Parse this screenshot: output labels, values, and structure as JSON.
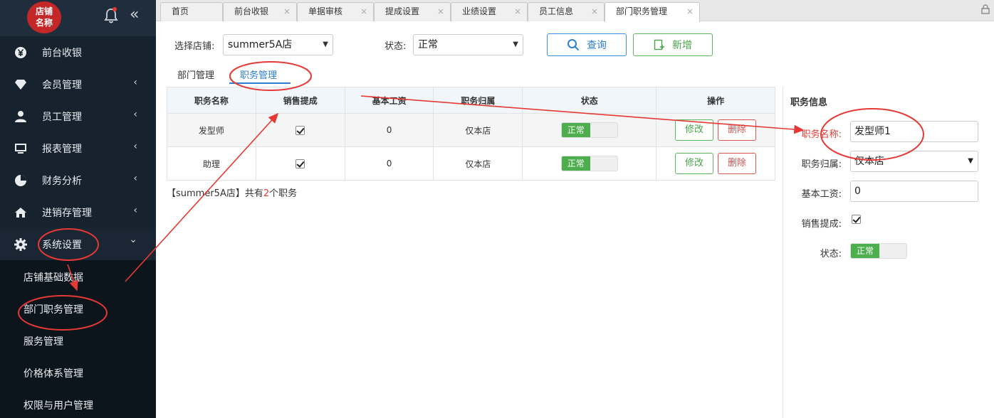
{
  "sidebar": {
    "logo_line1": "店铺",
    "logo_line2": "名称",
    "collapse_glyph": "«",
    "menu": [
      {
        "label": "前台收银",
        "icon": "yen-icon",
        "arrow": ""
      },
      {
        "label": "会员管理",
        "icon": "diamond-icon",
        "arrow": "‹"
      },
      {
        "label": "员工管理",
        "icon": "user-icon",
        "arrow": "‹"
      },
      {
        "label": "报表管理",
        "icon": "monitor-icon",
        "arrow": "‹"
      },
      {
        "label": "财务分析",
        "icon": "pie-chart-icon",
        "arrow": "‹"
      },
      {
        "label": "进销存管理",
        "icon": "home-icon",
        "arrow": "‹"
      },
      {
        "label": "系统设置",
        "icon": "gear-icon",
        "arrow": "⌄"
      }
    ],
    "submenu": [
      "店铺基础数据",
      "部门职务管理",
      "服务管理",
      "价格体系管理",
      "权限与用户管理"
    ]
  },
  "tabs": [
    {
      "label": "首页",
      "close": ""
    },
    {
      "label": "前台收银",
      "close": "×"
    },
    {
      "label": "单据审核",
      "close": "×"
    },
    {
      "label": "提成设置",
      "close": "×"
    },
    {
      "label": "业绩设置",
      "close": "×"
    },
    {
      "label": "员工信息",
      "close": "×"
    },
    {
      "label": "部门职务管理",
      "close": "×"
    }
  ],
  "filters": {
    "store_label": "选择店铺:",
    "store_value": "summer5A店",
    "status_label": "状态:",
    "status_value": "正常",
    "query_label": "查询",
    "add_label": "新增"
  },
  "subtabs": {
    "dept": "部门管理",
    "job": "职务管理"
  },
  "table": {
    "headers": [
      "职务名称",
      "销售提成",
      "基本工资",
      "职务归属",
      "状态",
      "操作"
    ],
    "rows": [
      {
        "name": "发型师",
        "wage": "0",
        "scope": "仅本店",
        "status": "正常",
        "edit": "修改",
        "del": "删除"
      },
      {
        "name": "助理",
        "wage": "0",
        "scope": "仅本店",
        "status": "正常",
        "edit": "修改",
        "del": "删除"
      }
    ]
  },
  "summary": {
    "prefix": "【summer5A店】共有",
    "count": "2",
    "suffix": "个职务"
  },
  "panel": {
    "title": "职务信息",
    "name_label": "职务名称:",
    "name_value": "发型师1",
    "scope_label": "职务归属:",
    "scope_value": "仅本店",
    "wage_label": "基本工资:",
    "wage_value": "0",
    "commission_label": "销售提成:",
    "status_label": "状态:",
    "status_value": "正常"
  },
  "colors": {
    "sidebar_bg": "#16222e",
    "accent_blue": "#2d7fd0",
    "green": "#4cae4c",
    "red": "#e53935"
  }
}
